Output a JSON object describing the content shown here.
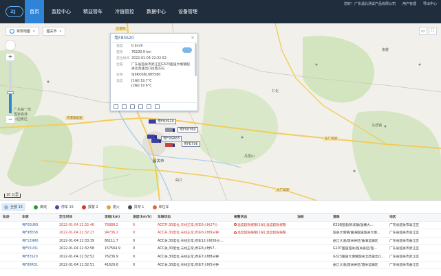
{
  "header": {
    "logo": "ZJ",
    "nav": [
      {
        "label": "首页",
        "active": true
      },
      {
        "label": "监控中心",
        "active": false
      },
      {
        "label": "精益管车",
        "active": false
      },
      {
        "label": "冷链管控",
        "active": false
      },
      {
        "label": "数据中心",
        "active": false
      },
      {
        "label": "设备管理",
        "active": false
      }
    ],
    "right": [
      "您好！广东温北测试产品有限公司",
      "用户管理",
      "导出中心"
    ]
  },
  "map": {
    "map_type": "常规地图",
    "region": "韶关市",
    "scale_text": "10 公里",
    "labels": {
      "north_area": "七星岭",
      "park": "广东曲一坊\n国家森林\n公园景区",
      "scenic": "丹霞山",
      "town1": "乌迳镇",
      "town2": "仁化",
      "town3": "南雄",
      "town4": "曲江",
      "city": "韶关市",
      "road1": "京港澳高速",
      "road2": "乐广高速",
      "road3": "大广高速"
    },
    "vehicles": [
      {
        "plate": "粤F83S20"
      },
      {
        "plate": "粤F00Y60"
      },
      {
        "plate": "粤F9SR83"
      },
      {
        "plate": "粤FE796"
      }
    ],
    "popup": {
      "title": "粤F83S20",
      "rows": [
        {
          "k": "速度",
          "v": "0 km/h"
        },
        {
          "k": "里程",
          "v": "76230.9 km"
        },
        {
          "k": "定位时间",
          "v": "2022-01-04 22:32:52"
        },
        {
          "k": "位置",
          "v": "广东省韶关市武江区G323国道大塘镇韶关北高速出口往西方向"
        },
        {
          "k": "车牌",
          "v": "SJ9ROSB1985580"
        },
        {
          "k": "温度",
          "v": "[1探] 19.7°C"
        },
        {
          "k": "",
          "v": "[2探] 19.6°C"
        }
      ]
    }
  },
  "filters": [
    {
      "label": "全部",
      "count": "15",
      "color": "#9db6d6",
      "active": true
    },
    {
      "label": "离线",
      "count": "",
      "color": "#1d9c3f",
      "active": false
    },
    {
      "label": "停车",
      "count": "15",
      "color": "#5a3fa5",
      "active": false
    },
    {
      "label": "报警",
      "count": "2",
      "color": "#d2382f",
      "active": false
    },
    {
      "label": "熄火",
      "count": "",
      "color": "#e0a23c",
      "active": false
    },
    {
      "label": "异常",
      "count": "1",
      "color": "#4a4a4a",
      "active": false
    },
    {
      "label": "单位车",
      "count": "",
      "color": "#e06a3c",
      "active": false
    }
  ],
  "table": {
    "columns": [
      "轨迹",
      "车牌",
      "定位时间",
      "里程(km)",
      "速度(km/h)",
      "车辆状态",
      "报警状态",
      "油耗",
      "道路",
      "地区"
    ],
    "rows": [
      {
        "plate": "粤F00U60",
        "time": "2022-01-04 22:32:46",
        "mileage": "76888.2",
        "speed": "0",
        "status": "ACC开,30度位,天线正常,停车6小时27分",
        "alarm": "温度超限报警(1探),温度超限报警",
        "oil": "",
        "road": "K316国道/新溪镇/温棚大...",
        "area": "广东省韶关市翁江区",
        "red": true
      },
      {
        "plate": "粤F9B558",
        "time": "2022-01-04 22:32:27",
        "mileage": "94736.2",
        "speed": "0",
        "status": "ACC开,30度位,天线正常,停车6小时9分钟",
        "alarm": "温度超限报警(1探),温度超限报警",
        "oil": "",
        "road": "韶关大塘镇/曲海国道韶关大塘...",
        "area": "广东省韶关市翁江区",
        "red": true
      },
      {
        "plate": "粤F12NR6",
        "time": "2022-01-04 22:33:39",
        "mileage": "86111.7",
        "speed": "0",
        "status": "ACC关,30度位,天线正常,停车12小时56分...",
        "alarm": "",
        "oil": "",
        "road": "曲江大道/韶关县区/曲海运输区",
        "area": "广东省韶关市曲江区",
        "red": false
      },
      {
        "plate": "粤F55U31",
        "time": "2022-01-04 22:32:58",
        "mileage": "157564.9",
        "speed": "0",
        "status": "ACC关,30度位,天线正常,停车6小时57...",
        "alarm": "",
        "oil": "",
        "road": "G107国道韶关/韶关县区/韶...",
        "area": "广东省韶关市武江区",
        "red": false
      },
      {
        "plate": "粤F83S20",
        "time": "2022-01-04 22:32:52",
        "mileage": "76236.9",
        "speed": "0",
        "status": "ACC关,30度位,天线正常,停车7小时8分钟",
        "alarm": "",
        "oil": "",
        "road": "G323国道大塘镇韶关北高速出口...",
        "area": "广东省韶关市武江区",
        "red": false
      },
      {
        "plate": "粤F88R31",
        "time": "2022-01-04 22:32:51",
        "mileage": "41626.6",
        "speed": "0",
        "status": "ACC关,30度位,天线正常,停车7小时5分钟",
        "alarm": "",
        "oil": "",
        "road": "曲江大道/韶关县区/韶关运输区",
        "area": "广东省韶关市曲江区",
        "red": false
      }
    ]
  }
}
